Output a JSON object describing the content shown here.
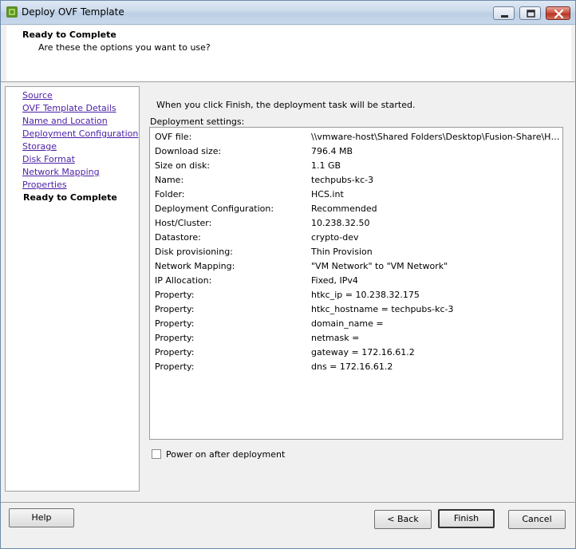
{
  "window": {
    "title": "Deploy OVF Template",
    "icons": {
      "app": "vsphere-deploy-icon",
      "minimize": "minimize-icon",
      "maximize": "maximize-icon",
      "close": "close-icon"
    }
  },
  "header": {
    "title": "Ready to Complete",
    "subtitle": "Are these the options you want to use?"
  },
  "nav": {
    "items": [
      {
        "label": "Source",
        "state": "link"
      },
      {
        "label": "OVF Template Details",
        "state": "link"
      },
      {
        "label": "Name and Location",
        "state": "link"
      },
      {
        "label": "Deployment Configuration",
        "state": "link"
      },
      {
        "label": "Storage",
        "state": "link"
      },
      {
        "label": "Disk Format",
        "state": "link"
      },
      {
        "label": "Network Mapping",
        "state": "link"
      },
      {
        "label": "Properties",
        "state": "link"
      },
      {
        "label": "Ready to Complete",
        "state": "current"
      }
    ]
  },
  "main": {
    "intro": "When you click Finish, the deployment task will be started.",
    "settings_label": "Deployment settings:",
    "settings": [
      {
        "key": "OVF file:",
        "value": "\\\\vmware-host\\Shared Folders\\Desktop\\Fusion-Share\\HyT..."
      },
      {
        "key": "Download size:",
        "value": "796.4 MB"
      },
      {
        "key": "Size on disk:",
        "value": "1.1 GB"
      },
      {
        "key": "Name:",
        "value": "techpubs-kc-3"
      },
      {
        "key": "Folder:",
        "value": "HCS.int"
      },
      {
        "key": "Deployment Configuration:",
        "value": "Recommended"
      },
      {
        "key": "Host/Cluster:",
        "value": "10.238.32.50"
      },
      {
        "key": "Datastore:",
        "value": "crypto-dev"
      },
      {
        "key": "Disk provisioning:",
        "value": "Thin Provision"
      },
      {
        "key": "Network Mapping:",
        "value": "\"VM Network\" to \"VM Network\""
      },
      {
        "key": "IP Allocation:",
        "value": "Fixed, IPv4"
      },
      {
        "key": "Property:",
        "value": "htkc_ip = 10.238.32.175"
      },
      {
        "key": "Property:",
        "value": "htkc_hostname = techpubs-kc-3"
      },
      {
        "key": "Property:",
        "value": "domain_name ="
      },
      {
        "key": "Property:",
        "value": "netmask ="
      },
      {
        "key": "Property:",
        "value": "gateway = 172.16.61.2"
      },
      {
        "key": "Property:",
        "value": "dns = 172.16.61.2"
      }
    ],
    "power_on": {
      "label": "Power on after deployment",
      "checked": false
    }
  },
  "buttons": {
    "help": "Help",
    "back": "< Back",
    "finish": "Finish",
    "cancel": "Cancel"
  }
}
